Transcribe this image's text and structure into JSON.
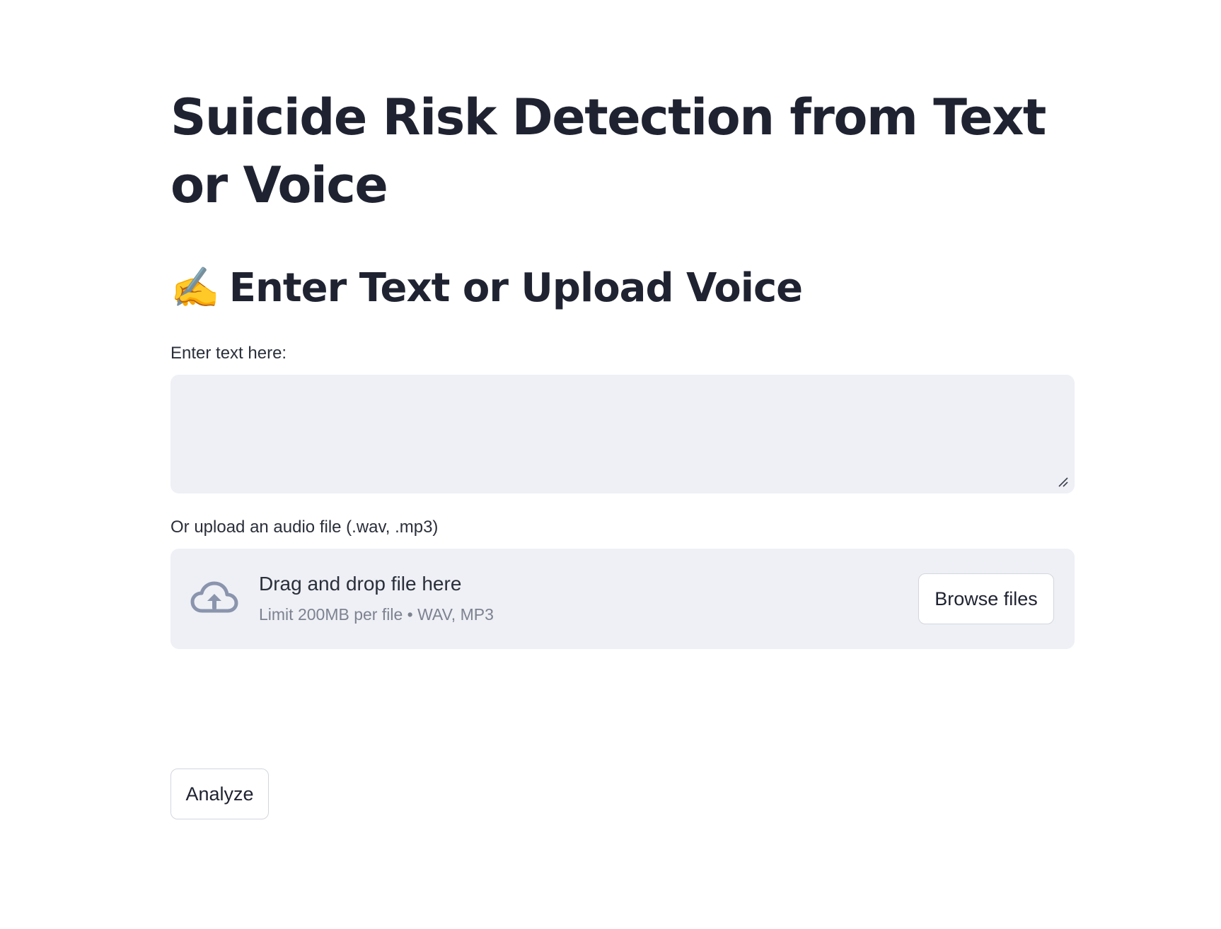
{
  "header": {
    "title": "Suicide Risk Detection from Text or Voice"
  },
  "input_section": {
    "emoji": "✍️",
    "heading": "Enter Text or Upload Voice",
    "text_label": "Enter text here:",
    "text_value": "",
    "text_placeholder": ""
  },
  "upload": {
    "label": "Or upload an audio file (.wav, .mp3)",
    "drop_text": "Drag and drop file here",
    "limit_text": "Limit 200MB per file • WAV, MP3",
    "browse_label": "Browse files",
    "icon": "cloud-upload-icon"
  },
  "actions": {
    "analyze_label": "Analyze"
  },
  "colors": {
    "input_background": "#eef0f5",
    "text_primary": "#1f2331",
    "text_muted": "#7d8290",
    "icon_color": "#8a94ad"
  }
}
